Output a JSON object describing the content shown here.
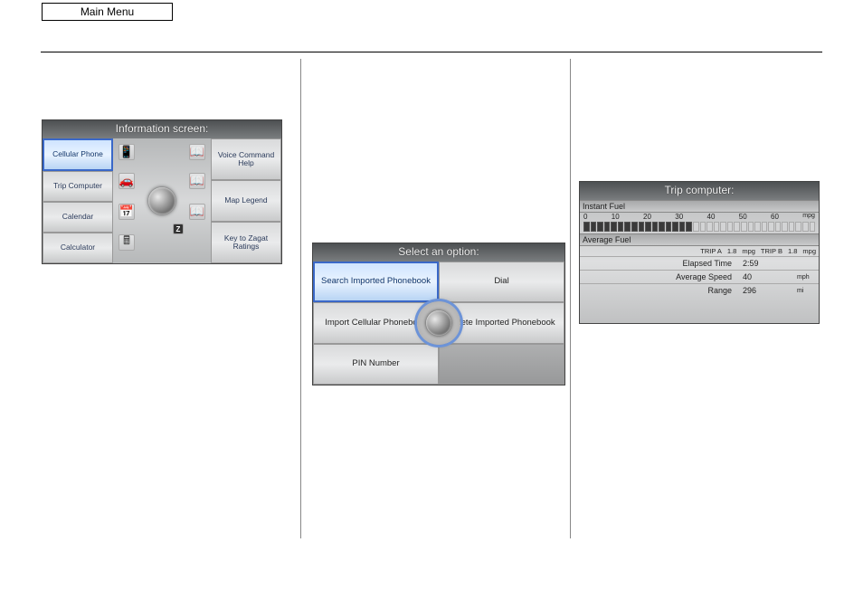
{
  "main_menu_label": "Main Menu",
  "device1": {
    "title": "Information screen:",
    "left_buttons": [
      "Cellular Phone",
      "Trip Computer",
      "Calendar",
      "Calculator"
    ],
    "right_buttons": [
      "Voice Command Help",
      "Map Legend",
      "Key to Zagat Ratings"
    ],
    "icons": {
      "phone": "📱",
      "book1": "📖",
      "car": "🚗",
      "book2": "📖",
      "cal": "📅",
      "book3": "📖",
      "calc": "🖩",
      "z": "Z"
    }
  },
  "device2": {
    "title": "Select an option:",
    "buttons": {
      "search": "Search Imported Phonebook",
      "dial": "Dial",
      "import": "Import Cellular Phonebook",
      "delete": "Delete Imported Phonebook",
      "pin": "PIN Number"
    }
  },
  "device3": {
    "title": "Trip computer:",
    "instant_fuel_label": "Instant Fuel",
    "scale": [
      "0",
      "10",
      "20",
      "30",
      "40",
      "50",
      "60"
    ],
    "scale_unit": "mpg",
    "average_fuel_label": "Average Fuel",
    "trip_a_label": "TRIP A",
    "trip_a_val": "1.8",
    "trip_a_unit": "mpg",
    "trip_b_label": "TRIP B",
    "trip_b_val": "1.8",
    "trip_b_unit": "mpg",
    "rows": [
      {
        "label": "Elapsed Time",
        "value": "2:59",
        "unit": ""
      },
      {
        "label": "Average Speed",
        "value": "40",
        "unit": "mph"
      },
      {
        "label": "Range",
        "value": "296",
        "unit": "mi"
      }
    ],
    "filled_bars": 16,
    "total_bars": 34
  }
}
